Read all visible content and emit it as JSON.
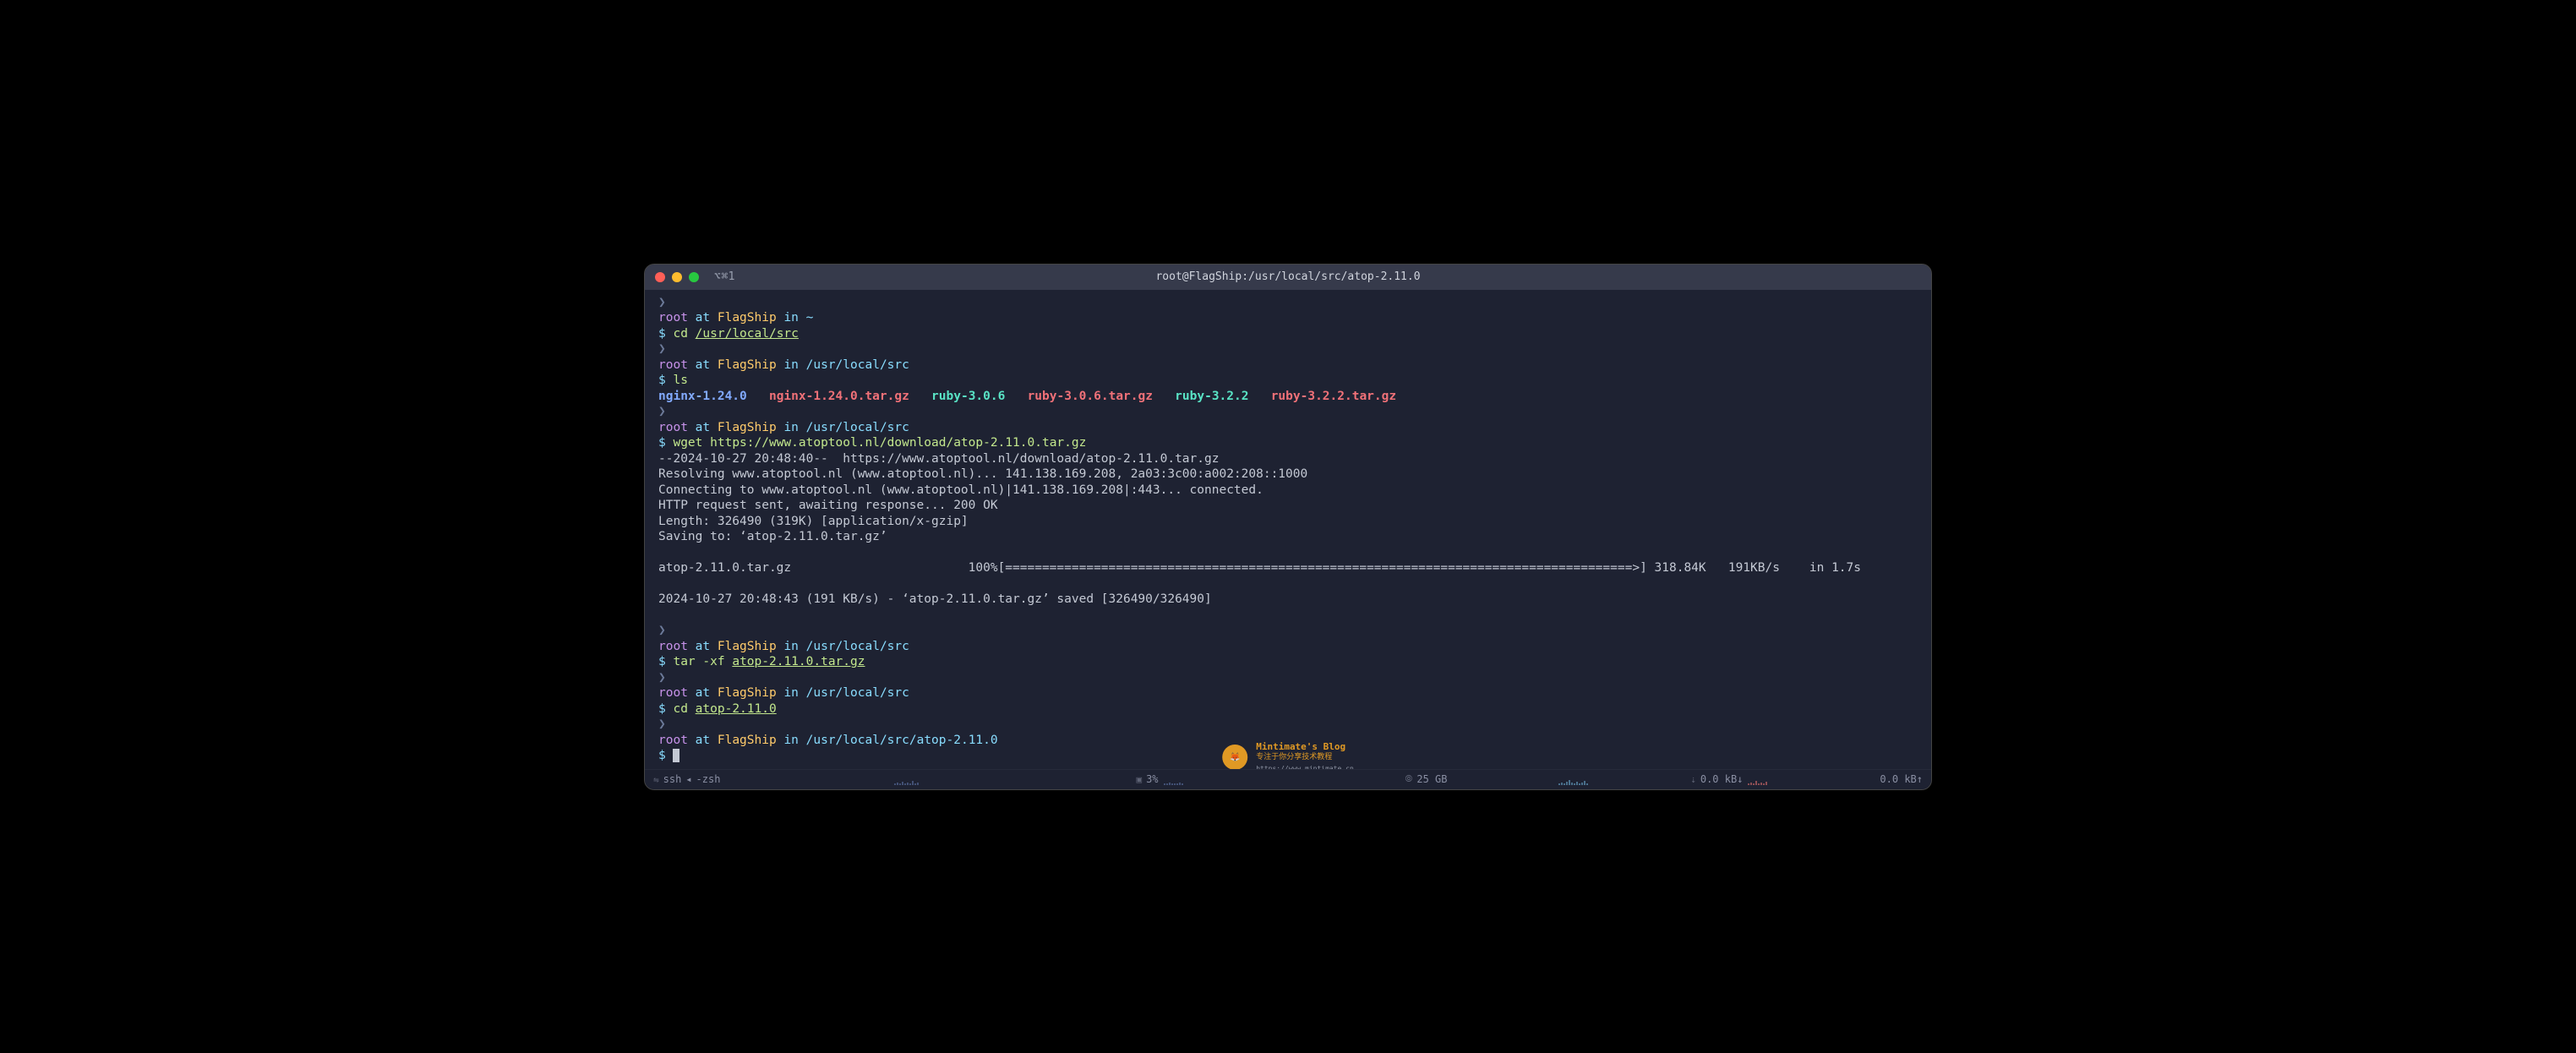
{
  "titlebar": {
    "tab": "⌥⌘1",
    "title": "root@FlagShip:/usr/local/src/atop-2.11.0"
  },
  "prompts": [
    {
      "user": "root",
      "at": "at",
      "host": "FlagShip",
      "in": "in",
      "path": "~",
      "cmd_prefix": "cd",
      "cmd_arg": "/usr/local/src"
    },
    {
      "user": "root",
      "at": "at",
      "host": "FlagShip",
      "in": "in",
      "path": "/usr/local/src",
      "cmd_prefix": "ls",
      "cmd_arg": ""
    },
    {
      "user": "root",
      "at": "at",
      "host": "FlagShip",
      "in": "in",
      "path": "/usr/local/src",
      "cmd_prefix": "wget",
      "cmd_arg": "https://www.atoptool.nl/download/atop-2.11.0.tar.gz"
    },
    {
      "user": "root",
      "at": "at",
      "host": "FlagShip",
      "in": "in",
      "path": "/usr/local/src",
      "cmd_prefix": "tar",
      "cmd_arg_pre": "-xf",
      "cmd_arg": "atop-2.11.0.tar.gz"
    },
    {
      "user": "root",
      "at": "at",
      "host": "FlagShip",
      "in": "in",
      "path": "/usr/local/src",
      "cmd_prefix": "cd",
      "cmd_arg": "atop-2.11.0"
    },
    {
      "user": "root",
      "at": "at",
      "host": "FlagShip",
      "in": "in",
      "path": "/usr/local/src/atop-2.11.0",
      "cmd_prefix": "",
      "cmd_arg": ""
    }
  ],
  "ls_output": {
    "items": [
      {
        "name": "nginx-1.24.0",
        "type": "dir-blue"
      },
      {
        "name": "nginx-1.24.0.tar.gz",
        "type": "file-red"
      },
      {
        "name": "ruby-3.0.6",
        "type": "dir-teal"
      },
      {
        "name": "ruby-3.0.6.tar.gz",
        "type": "file-red"
      },
      {
        "name": "ruby-3.2.2",
        "type": "dir-teal"
      },
      {
        "name": "ruby-3.2.2.tar.gz",
        "type": "file-red"
      }
    ]
  },
  "wget": {
    "l1": "--2024-10-27 20:48:40--  https://www.atoptool.nl/download/atop-2.11.0.tar.gz",
    "l2": "Resolving www.atoptool.nl (www.atoptool.nl)... 141.138.169.208, 2a03:3c00:a002:208::1000",
    "l3": "Connecting to www.atoptool.nl (www.atoptool.nl)|141.138.169.208|:443... connected.",
    "l4": "HTTP request sent, awaiting response... 200 OK",
    "l5": "Length: 326490 (319K) [application/x-gzip]",
    "l6": "Saving to: ‘atop-2.11.0.tar.gz’",
    "progress_name": "atop-2.11.0.tar.gz",
    "progress_pct": "100%",
    "progress_bar": "[=====================================================================================>]",
    "progress_size": "318.84K",
    "progress_speed": "191KB/s",
    "progress_eta": "in 1.7s",
    "done": "2024-10-27 20:48:43 (191 KB/s) - ‘atop-2.11.0.tar.gz’ saved [326490/326490]"
  },
  "statusbar": {
    "ssh": "ssh",
    "shell": "-zsh",
    "cpu": "3%",
    "disk": "25 GB",
    "net_down": "0.0 kB↓",
    "net_up": "0.0 kB↑"
  },
  "watermark": {
    "t1": "Mintimate's Blog",
    "t2": "专注于你分享技术教程",
    "t3": "https://www.mintimate.cn"
  },
  "glyphs": {
    "arrow": "❯",
    "dollar": "$",
    "triangle_left": "◂"
  }
}
